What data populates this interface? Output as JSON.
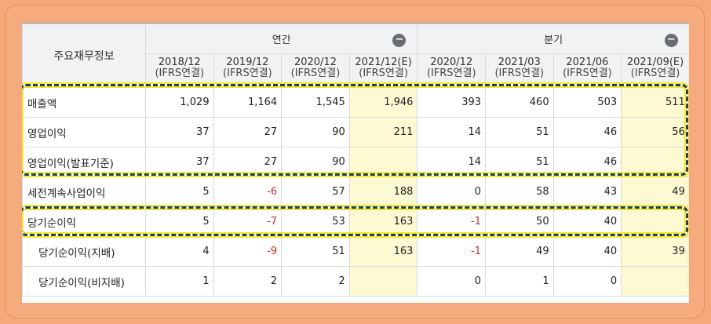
{
  "table": {
    "corner_label": "주요재무정보",
    "groups": {
      "annual": "연간",
      "quarterly": "분기",
      "collapse_symbol": "−"
    },
    "periods": [
      {
        "date": "2018/12",
        "basis": "(IFRS연결)"
      },
      {
        "date": "2019/12",
        "basis": "(IFRS연결)"
      },
      {
        "date": "2020/12",
        "basis": "(IFRS연결)"
      },
      {
        "date": "2021/12(E)",
        "basis": "(IFRS연결)"
      },
      {
        "date": "2020/12",
        "basis": "(IFRS연결)"
      },
      {
        "date": "2021/03",
        "basis": "(IFRS연결)"
      },
      {
        "date": "2021/06",
        "basis": "(IFRS연결)"
      },
      {
        "date": "2021/09(E)",
        "basis": "(IFRS연결)"
      }
    ],
    "rows": [
      {
        "label": "매출액",
        "values": [
          "1,029",
          "1,164",
          "1,545",
          "1,946",
          "393",
          "460",
          "503",
          "511"
        ]
      },
      {
        "label": "영업이익",
        "values": [
          "37",
          "27",
          "90",
          "211",
          "14",
          "51",
          "46",
          "56"
        ]
      },
      {
        "label": "영업이익(발표기준)",
        "values": [
          "37",
          "27",
          "90",
          "",
          "14",
          "51",
          "46",
          ""
        ]
      },
      {
        "label": "세전계속사업이익",
        "values": [
          "5",
          "-6",
          "57",
          "188",
          "0",
          "58",
          "43",
          "49"
        ]
      },
      {
        "label": "당기순이익",
        "values": [
          "5",
          "-7",
          "53",
          "163",
          "-1",
          "50",
          "40",
          ""
        ]
      },
      {
        "label": "당기순이익(지배)",
        "values": [
          "4",
          "-9",
          "51",
          "163",
          "-1",
          "49",
          "40",
          "39"
        ]
      },
      {
        "label": "당기순이익(비지배)",
        "values": [
          "1",
          "2",
          "2",
          "",
          "0",
          "1",
          "0",
          ""
        ]
      }
    ]
  },
  "colors": {
    "background": "#f5a97a",
    "estimate_cell": "#fdf9d3",
    "negative": "#c0302a",
    "highlight_dash": "#1f3f5a",
    "highlight_glow": "#f2ea2a"
  }
}
